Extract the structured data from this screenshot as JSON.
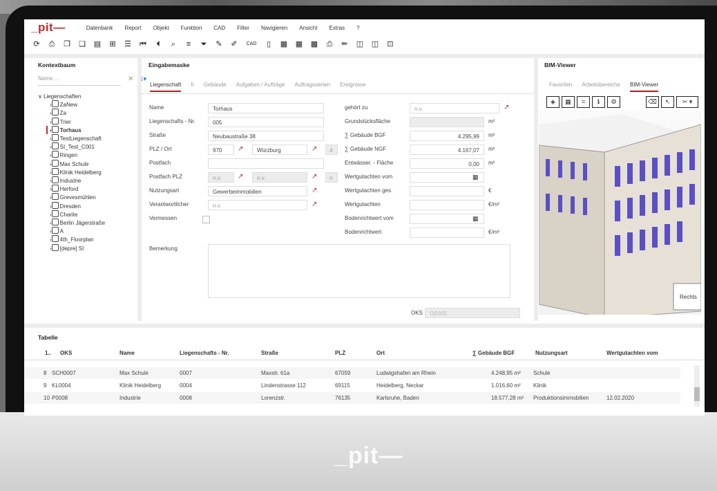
{
  "menubar": {
    "logo": "_pit—",
    "items": [
      "Datenbank",
      "Report",
      "Objekt",
      "Funktion",
      "CAD",
      "Filter",
      "Navigieren",
      "Ansicht",
      "Extras",
      "?"
    ]
  },
  "toolbar": {
    "icons": [
      "refresh-icon",
      "print-icon",
      "copy-icon",
      "duplicate-icon",
      "paste-icon",
      "tree-icon",
      "list-icon",
      "first-icon",
      "prev-icon",
      "search-icon",
      "filter-list-icon",
      "filter-icon",
      "pen-icon",
      "pencil-icon",
      "cad-icon",
      "doc-icon",
      "table-icon",
      "table2-icon",
      "grid-icon",
      "print2-icon",
      "edit2-icon",
      "window-icon",
      "window2-icon",
      "lock-icon"
    ],
    "cad_label": "CAD"
  },
  "kontextbaum": {
    "title": "Kontextbaum",
    "search_placeholder": "Name ...",
    "root": "Liegenschaften",
    "items": [
      "ZaNew",
      "Za",
      "Trier",
      "Torhaus",
      "TestLiegenschaft",
      "SI_Test_C001",
      "Ringen",
      "Max Schule",
      "Klinik Heidelberg",
      "Industrie",
      "Herford",
      "Grevesmühlen",
      "Dresden",
      "Charite",
      "Berlin Jägerstraße",
      "A",
      "4th_Floorplan",
      "[depre] SI"
    ],
    "selected": "Torhaus"
  },
  "eingabemaske": {
    "title": "Eingabemaske",
    "tabs": [
      "Liegenschaft",
      "II",
      "Gebäude",
      "Aufgaben / Aufträge",
      "Auftragsserien",
      "Ereignisse"
    ],
    "fields": {
      "name_label": "Name",
      "name_value": "Torhaus",
      "nr_label": "Liegenschafts - Nr.",
      "nr_value": "005",
      "strasse_label": "Straße",
      "strasse_value": "Neubaustraße 38",
      "plz_label": "PLZ / Ort",
      "plz_value": "970",
      "ort_value": "Würzburg",
      "plz_extra": "4",
      "postfach_label": "Postfach",
      "postfach_plz_label": "Postfach PLZ",
      "postfach_plz_value": "n.v.",
      "postfach_ort_value": "n.v.",
      "postfach_extra": "n",
      "nutzungsart_label": "Nutzungsart",
      "nutzungsart_value": "Gewerbeimmobilien",
      "verantwortlicher_label": "Verantwortlicher",
      "verantwortlicher_value": "n.v.",
      "vermessen_label": "Vermessen",
      "gehoert_label": "gehört zu",
      "gehoert_value": "n.v.",
      "grundstueck_label": "Grundstücksfläche",
      "grundstueck_unit": "m²",
      "bgf_label": "∑ Gebäude BGF",
      "bgf_value": "4.295,99",
      "bgf_unit": "m²",
      "ngf_label": "∑ Gebäude NGF",
      "ngf_value": "4.167,07",
      "ngf_unit": "m²",
      "entw_label": "Entwässer. - Fläche",
      "entw_value": "0,00",
      "entw_unit": "m²",
      "wg_vom_label": "Wertgutachten vom",
      "wg_ges_label": "Wertgutachten ges.",
      "wg_ges_unit": "€",
      "wg_label": "Wertgutachten",
      "wg_unit": "€/m²",
      "brw_vom_label": "Bodenrichtwert vom",
      "brw_label": "Bodenrichtwert",
      "brw_unit": "€/m²",
      "bemerkung_label": "Bemerkung",
      "oks_label": "OKS",
      "oks_value": "GE005"
    }
  },
  "bim": {
    "title": "BIM-Viewer",
    "tabs": [
      "Favoriten",
      "Arbeitsbereiche",
      "BIM-Viewer"
    ],
    "sign_text": "Rechts"
  },
  "tabelle": {
    "title": "Tabelle",
    "headers": [
      "1..",
      "OKS",
      "Name",
      "Liegenschafts - Nr.",
      "Straße",
      "PLZ",
      "Ort",
      "∑ Gebäude BGF",
      "Nutzungsart",
      "Wertgutachten vom"
    ],
    "rows": [
      [
        "8",
        "SCH0007",
        "Max Schule",
        "0007",
        "Maxstr. 61a",
        "67059",
        "Ludwigshafen am Rhein",
        "4.248,95 m²",
        "Schule",
        ""
      ],
      [
        "9",
        "KL0004",
        "Klinik Heidelberg",
        "0004",
        "Lindenstrasse 112",
        "69115",
        "Heidelberg, Neckar",
        "1.016,60 m²",
        "Klinik",
        ""
      ],
      [
        "10",
        "P0008",
        "Industrie",
        "0008",
        "Lorenzstr.",
        "76135",
        "Karlsruhe, Baden",
        "18.577,28 m²",
        "Produktionsimmobilien",
        "12.02.2020"
      ]
    ]
  },
  "chin_logo": "_pit—"
}
